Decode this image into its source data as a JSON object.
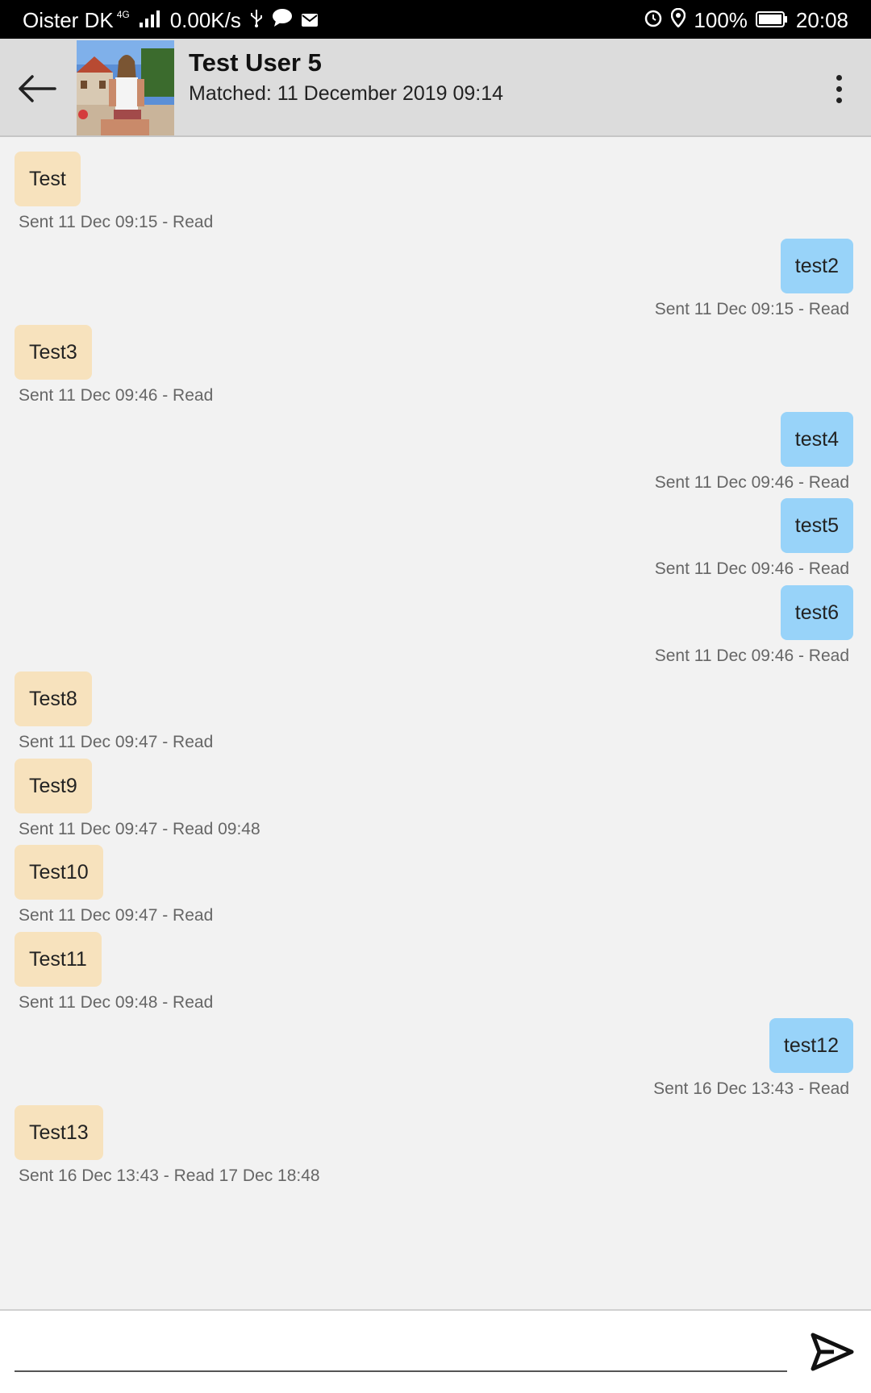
{
  "status_bar": {
    "carrier": "Oister DK",
    "network": "4G",
    "speed": "0.00K/s",
    "battery": "100%",
    "time": "20:08"
  },
  "header": {
    "title": "Test User 5",
    "subtitle": "Matched: 11 December 2019 09:14"
  },
  "messages": [
    {
      "text": "Test",
      "meta": "Sent 11 Dec 09:15 - Read",
      "direction": "in"
    },
    {
      "text": "test2",
      "meta": "Sent 11 Dec 09:15 - Read",
      "direction": "out"
    },
    {
      "text": "Test3",
      "meta": "Sent 11 Dec 09:46 - Read",
      "direction": "in"
    },
    {
      "text": "test4",
      "meta": "Sent 11 Dec 09:46 - Read",
      "direction": "out"
    },
    {
      "text": "test5",
      "meta": "Sent 11 Dec 09:46 - Read",
      "direction": "out"
    },
    {
      "text": "test6",
      "meta": "Sent 11 Dec 09:46 - Read",
      "direction": "out"
    },
    {
      "text": "Test8",
      "meta": "Sent 11 Dec 09:47 - Read",
      "direction": "in"
    },
    {
      "text": "Test9",
      "meta": "Sent 11 Dec 09:47 - Read 09:48",
      "direction": "in"
    },
    {
      "text": "Test10",
      "meta": "Sent 11 Dec 09:47 - Read",
      "direction": "in"
    },
    {
      "text": "Test11",
      "meta": "Sent 11 Dec 09:48 - Read",
      "direction": "in"
    },
    {
      "text": "test12",
      "meta": "Sent 16 Dec 13:43 - Read",
      "direction": "out"
    },
    {
      "text": "Test13",
      "meta": "Sent 16 Dec 13:43 - Read 17 Dec 18:48",
      "direction": "in"
    }
  ],
  "composer": {
    "input_value": "",
    "placeholder": ""
  },
  "colors": {
    "incoming_bubble": "#f7e2bd",
    "outgoing_bubble": "#98d3f9",
    "header_bg": "#dcdcdc",
    "chat_bg": "#f2f2f2"
  },
  "icons": {
    "back": "arrow-left-icon",
    "more": "more-vert-icon",
    "send": "send-icon"
  }
}
